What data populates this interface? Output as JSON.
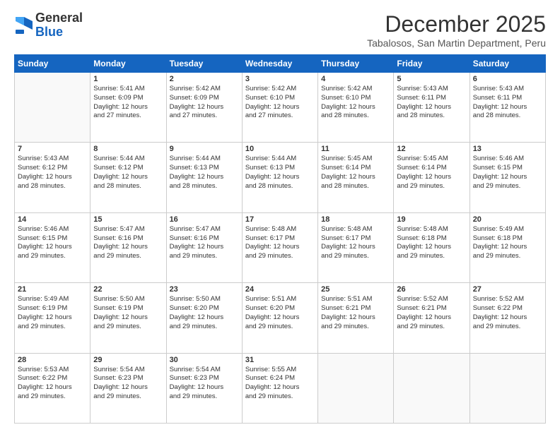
{
  "logo": {
    "general": "General",
    "blue": "Blue"
  },
  "header": {
    "month_year": "December 2025",
    "location": "Tabalosos, San Martin Department, Peru"
  },
  "weekdays": [
    "Sunday",
    "Monday",
    "Tuesday",
    "Wednesday",
    "Thursday",
    "Friday",
    "Saturday"
  ],
  "weeks": [
    [
      {
        "day": "",
        "info": ""
      },
      {
        "day": "1",
        "info": "Sunrise: 5:41 AM\nSunset: 6:09 PM\nDaylight: 12 hours\nand 27 minutes."
      },
      {
        "day": "2",
        "info": "Sunrise: 5:42 AM\nSunset: 6:09 PM\nDaylight: 12 hours\nand 27 minutes."
      },
      {
        "day": "3",
        "info": "Sunrise: 5:42 AM\nSunset: 6:10 PM\nDaylight: 12 hours\nand 27 minutes."
      },
      {
        "day": "4",
        "info": "Sunrise: 5:42 AM\nSunset: 6:10 PM\nDaylight: 12 hours\nand 28 minutes."
      },
      {
        "day": "5",
        "info": "Sunrise: 5:43 AM\nSunset: 6:11 PM\nDaylight: 12 hours\nand 28 minutes."
      },
      {
        "day": "6",
        "info": "Sunrise: 5:43 AM\nSunset: 6:11 PM\nDaylight: 12 hours\nand 28 minutes."
      }
    ],
    [
      {
        "day": "7",
        "info": "Sunrise: 5:43 AM\nSunset: 6:12 PM\nDaylight: 12 hours\nand 28 minutes."
      },
      {
        "day": "8",
        "info": "Sunrise: 5:44 AM\nSunset: 6:12 PM\nDaylight: 12 hours\nand 28 minutes."
      },
      {
        "day": "9",
        "info": "Sunrise: 5:44 AM\nSunset: 6:13 PM\nDaylight: 12 hours\nand 28 minutes."
      },
      {
        "day": "10",
        "info": "Sunrise: 5:44 AM\nSunset: 6:13 PM\nDaylight: 12 hours\nand 28 minutes."
      },
      {
        "day": "11",
        "info": "Sunrise: 5:45 AM\nSunset: 6:14 PM\nDaylight: 12 hours\nand 28 minutes."
      },
      {
        "day": "12",
        "info": "Sunrise: 5:45 AM\nSunset: 6:14 PM\nDaylight: 12 hours\nand 29 minutes."
      },
      {
        "day": "13",
        "info": "Sunrise: 5:46 AM\nSunset: 6:15 PM\nDaylight: 12 hours\nand 29 minutes."
      }
    ],
    [
      {
        "day": "14",
        "info": "Sunrise: 5:46 AM\nSunset: 6:15 PM\nDaylight: 12 hours\nand 29 minutes."
      },
      {
        "day": "15",
        "info": "Sunrise: 5:47 AM\nSunset: 6:16 PM\nDaylight: 12 hours\nand 29 minutes."
      },
      {
        "day": "16",
        "info": "Sunrise: 5:47 AM\nSunset: 6:16 PM\nDaylight: 12 hours\nand 29 minutes."
      },
      {
        "day": "17",
        "info": "Sunrise: 5:48 AM\nSunset: 6:17 PM\nDaylight: 12 hours\nand 29 minutes."
      },
      {
        "day": "18",
        "info": "Sunrise: 5:48 AM\nSunset: 6:17 PM\nDaylight: 12 hours\nand 29 minutes."
      },
      {
        "day": "19",
        "info": "Sunrise: 5:48 AM\nSunset: 6:18 PM\nDaylight: 12 hours\nand 29 minutes."
      },
      {
        "day": "20",
        "info": "Sunrise: 5:49 AM\nSunset: 6:18 PM\nDaylight: 12 hours\nand 29 minutes."
      }
    ],
    [
      {
        "day": "21",
        "info": "Sunrise: 5:49 AM\nSunset: 6:19 PM\nDaylight: 12 hours\nand 29 minutes."
      },
      {
        "day": "22",
        "info": "Sunrise: 5:50 AM\nSunset: 6:19 PM\nDaylight: 12 hours\nand 29 minutes."
      },
      {
        "day": "23",
        "info": "Sunrise: 5:50 AM\nSunset: 6:20 PM\nDaylight: 12 hours\nand 29 minutes."
      },
      {
        "day": "24",
        "info": "Sunrise: 5:51 AM\nSunset: 6:20 PM\nDaylight: 12 hours\nand 29 minutes."
      },
      {
        "day": "25",
        "info": "Sunrise: 5:51 AM\nSunset: 6:21 PM\nDaylight: 12 hours\nand 29 minutes."
      },
      {
        "day": "26",
        "info": "Sunrise: 5:52 AM\nSunset: 6:21 PM\nDaylight: 12 hours\nand 29 minutes."
      },
      {
        "day": "27",
        "info": "Sunrise: 5:52 AM\nSunset: 6:22 PM\nDaylight: 12 hours\nand 29 minutes."
      }
    ],
    [
      {
        "day": "28",
        "info": "Sunrise: 5:53 AM\nSunset: 6:22 PM\nDaylight: 12 hours\nand 29 minutes."
      },
      {
        "day": "29",
        "info": "Sunrise: 5:54 AM\nSunset: 6:23 PM\nDaylight: 12 hours\nand 29 minutes."
      },
      {
        "day": "30",
        "info": "Sunrise: 5:54 AM\nSunset: 6:23 PM\nDaylight: 12 hours\nand 29 minutes."
      },
      {
        "day": "31",
        "info": "Sunrise: 5:55 AM\nSunset: 6:24 PM\nDaylight: 12 hours\nand 29 minutes."
      },
      {
        "day": "",
        "info": ""
      },
      {
        "day": "",
        "info": ""
      },
      {
        "day": "",
        "info": ""
      }
    ]
  ]
}
